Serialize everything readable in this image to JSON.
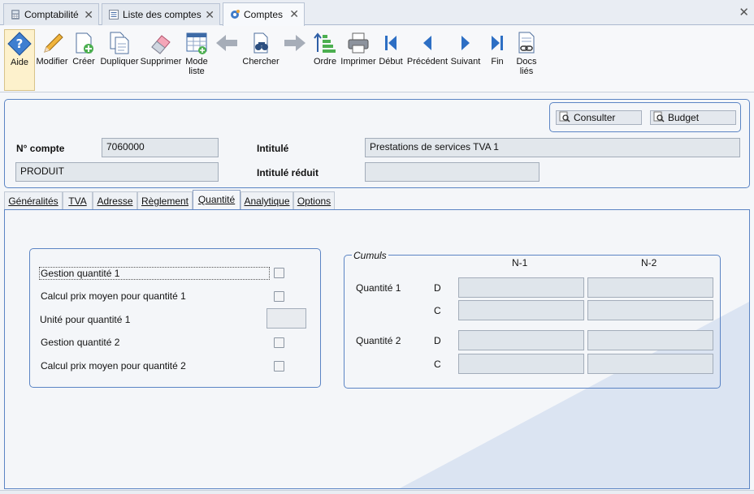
{
  "doc_tabs": [
    {
      "label": "Comptabilité",
      "icon": "calculator-icon"
    },
    {
      "label": "Liste des comptes",
      "icon": "list-icon"
    },
    {
      "label": "Comptes",
      "icon": "gear-icon"
    }
  ],
  "toolbar": {
    "aide": "Aide",
    "modifier": "Modifier",
    "creer": "Créer",
    "dupliquer": "Dupliquer",
    "supprimer": "Supprimer",
    "mode_liste_1": "Mode",
    "mode_liste_2": "liste",
    "chercher": "Chercher",
    "ordre": "Ordre",
    "imprimer": "Imprimer",
    "debut": "Début",
    "precedent": "Précédent",
    "suivant": "Suivant",
    "fin": "Fin",
    "docs_1": "Docs",
    "docs_2": "liés"
  },
  "header": {
    "consulter": "Consulter",
    "budget": "Budget",
    "numero_label": "N° compte",
    "numero_value": "7060000",
    "intitule_label": "Intitulé",
    "intitule_value": "Prestations de services TVA 1",
    "type_value": "PRODUIT",
    "intitule_reduit_label": "Intitulé réduit",
    "intitule_reduit_value": ""
  },
  "section_tabs": [
    {
      "label": "Généralités"
    },
    {
      "label": "TVA"
    },
    {
      "label": "Adresse"
    },
    {
      "label": "Règlement"
    },
    {
      "label": "Quantité"
    },
    {
      "label": "Analytique"
    },
    {
      "label": "Options"
    }
  ],
  "active_section_tab": "Quantité",
  "quantite": {
    "gestion_q1": "Gestion quantité 1",
    "calcul_q1": "Calcul prix moyen pour quantité 1",
    "unite_q1": "Unité pour quantité 1",
    "gestion_q2": "Gestion quantité 2",
    "calcul_q2": "Calcul prix moyen pour quantité 2"
  },
  "cumuls": {
    "title": "Cumuls",
    "col_n1": "N-1",
    "col_n2": "N-2",
    "quantite1": "Quantité 1",
    "quantite2": "Quantité 2",
    "debit": "D",
    "credit": "C"
  },
  "colors": {
    "accent_border": "#5b84c4",
    "field_bg": "#e2e7ec",
    "active_button_bg": "#fdf1cc"
  }
}
